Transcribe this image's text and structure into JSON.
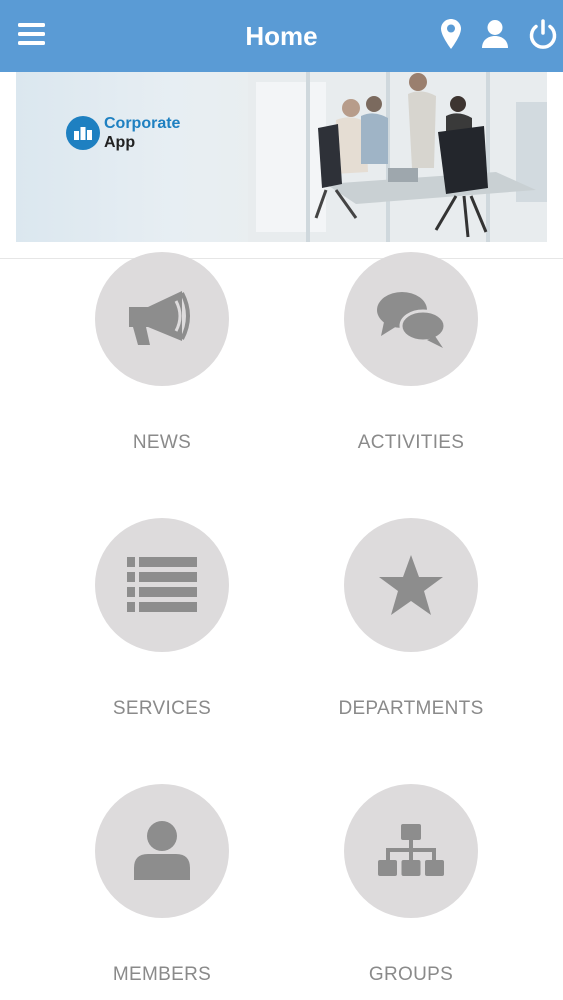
{
  "header": {
    "title": "Home",
    "icons": [
      "menu-icon",
      "location-pin-icon",
      "user-icon",
      "power-icon"
    ],
    "background": "#5a9bd5"
  },
  "banner": {
    "logo_line1": "Corporate",
    "logo_line2": "App",
    "logo_color": "#1e80c1"
  },
  "tiles": [
    {
      "label": "NEWS",
      "icon": "megaphone-icon"
    },
    {
      "label": "ACTIVITIES",
      "icon": "chat-bubbles-icon"
    },
    {
      "label": "SERVICES",
      "icon": "list-icon"
    },
    {
      "label": "DEPARTMENTS",
      "icon": "star-icon"
    },
    {
      "label": "MEMBERS",
      "icon": "member-icon"
    },
    {
      "label": "GROUPS",
      "icon": "org-chart-icon"
    }
  ],
  "colors": {
    "tile_circle": "#dddbdc",
    "tile_icon": "#8d8d8d",
    "tile_label": "#8a8a8a"
  }
}
